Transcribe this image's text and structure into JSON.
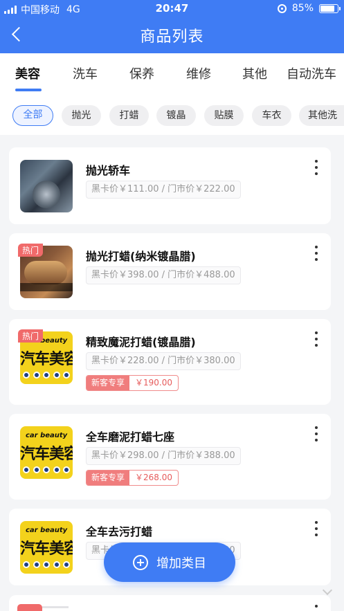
{
  "status_bar": {
    "carrier": "中国移动",
    "network": "4G",
    "time": "20:47",
    "battery": "85%",
    "battery_level": 0.85
  },
  "header": {
    "title": "商品列表"
  },
  "tabs": [
    "美容",
    "洗车",
    "保养",
    "维修",
    "其他",
    "自动洗车"
  ],
  "active_tab": "美容",
  "chips": [
    "全部",
    "抛光",
    "打蜡",
    "镀晶",
    "贴膜",
    "车衣",
    "其他"
  ],
  "active_chip": "全部",
  "products": [
    {
      "name": "抛光轿车",
      "price": "黑卡价￥111.00 / 门市价￥222.00",
      "hot": "",
      "promo_tag": "",
      "promo_price": "",
      "image": "photo-polishing"
    },
    {
      "name": "抛光打蜡(纳米镀晶腊)",
      "price": "黑卡价￥398.00 / 门市价￥488.00",
      "hot": "热门",
      "promo_tag": "",
      "promo_price": "",
      "image": "photo-wax"
    },
    {
      "name": "精致魔泥打蜡(镀晶腊)",
      "price": "黑卡价￥228.00 / 门市价￥380.00",
      "hot": "热门",
      "promo_tag": "新客专享",
      "promo_price": "￥190.00",
      "image": "car-beauty-logo"
    },
    {
      "name": "全车磨泥打蜡七座",
      "price": "黑卡价￥298.00 / 门市价￥388.00",
      "hot": "",
      "promo_tag": "新客专享",
      "promo_price": "￥268.00",
      "image": "car-beauty-logo"
    },
    {
      "name": "全车去污打蜡",
      "price": "黑卡价￥298.00 / 门市价￥388.00",
      "hot": "",
      "promo_tag": "",
      "promo_price": "",
      "image": "car-beauty-logo"
    }
  ],
  "logo_text": {
    "small": "car beauty",
    "big": "汽车美容"
  },
  "add_button": {
    "label": "增加类目"
  },
  "colors": {
    "primary": "#3f7cf4",
    "hot": "#f06a6a",
    "promo": "#e65b5b"
  }
}
